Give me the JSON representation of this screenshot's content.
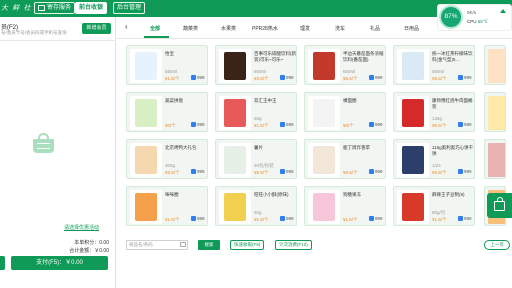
{
  "app": {
    "logo_text": "大  鲜  社",
    "top_buttons": [
      {
        "label": "寄存服务"
      },
      {
        "label": "前台收银"
      },
      {
        "label": "后台管理"
      }
    ]
  },
  "member": {
    "title": "员(F2)",
    "subtitle": "号/会员卡号/会员码或手机号查询",
    "add_button": "新增会员"
  },
  "cart": {
    "promo_link": "请选择优惠活动",
    "points_label": "本单积分：0.00",
    "total_label": "合计金额：￥0.00",
    "pay_button": "支付(F5)：￥0.00"
  },
  "categories": [
    {
      "label": "全部"
    },
    {
      "label": "蔬菜类"
    },
    {
      "label": "水果类"
    },
    {
      "label": "PPR28热水"
    },
    {
      "label": "理发"
    },
    {
      "label": "洗车"
    },
    {
      "label": "礼品"
    },
    {
      "label": "日用品"
    },
    {
      "label": "食"
    }
  ],
  "products": [
    {
      "name": "怡宝",
      "spec": "555ml",
      "price": "¥1.5/个",
      "stock": "999"
    },
    {
      "name": "百事可乐碳酸饮料(新装)可乐~可乐~",
      "spec": "600ml",
      "price": "¥3.5/个",
      "stock": "999"
    },
    {
      "name": "半边天番茄面条浓缩饮料(番茄面)",
      "spec": "600ml",
      "price": "¥5.5/个",
      "stock": "999"
    },
    {
      "name": "统一冰红茶柠檬味饮料(金气型)5…",
      "spec": "560ml",
      "price": "¥5.5/个",
      "stock": "999"
    },
    {
      "name": "蔬菜拼盘",
      "spec": "",
      "price": "¥0/个",
      "stock": "999"
    },
    {
      "name": "双汇王中王",
      "spec": "55g",
      "price": "¥1.5/个",
      "stock": "999"
    },
    {
      "name": "裸面圈",
      "spec": "",
      "price": "¥0/个",
      "stock": "999"
    },
    {
      "name": "康师傅红烧牛肉面桶装",
      "spec": "136g",
      "price": "¥5.5/个",
      "stock": "999"
    },
    {
      "name": "北京烤鸭大礼包",
      "spec": "300g",
      "price": "¥5.5/个",
      "stock": "999"
    },
    {
      "name": "薯片",
      "spec": "50包/份装",
      "price": "¥5.5/个",
      "stock": "999"
    },
    {
      "name": "鹿丁周炸香苹",
      "spec": "",
      "price": "¥5.5/个",
      "stock": "999"
    },
    {
      "name": "116g奥利奥巧心饼干饼",
      "spec": "1/24",
      "price": "¥5.5/个",
      "stock": "999"
    },
    {
      "name": "咪咪圈",
      "spec": "",
      "price": "¥1.5/个",
      "stock": "999"
    },
    {
      "name": "旺旺小小酥(原味)",
      "spec": "50g",
      "price": "¥1.5/个",
      "stock": "999"
    },
    {
      "name": "狗糖果冻",
      "spec": "",
      "price": "¥1.5/个",
      "stock": "999"
    },
    {
      "name": "麻辣王子豆制(9)",
      "spec": "90g/包",
      "price": "¥1.5/个",
      "stock": "999"
    }
  ],
  "bottom": {
    "search_placeholder": "商品名/条码",
    "search_button": "搜索",
    "quick_button": "快速收银(F9)",
    "count_button": "计次消费(F10)",
    "prev_button": "上一页"
  },
  "monitor": {
    "percent": "87%",
    "net": "0K/s",
    "cpu_label": "CPU",
    "cpu_value": "55℃"
  },
  "colors": {
    "brand": "#0f9a58",
    "price": "#f08a24",
    "stock_badge": "#2f7ff0"
  }
}
